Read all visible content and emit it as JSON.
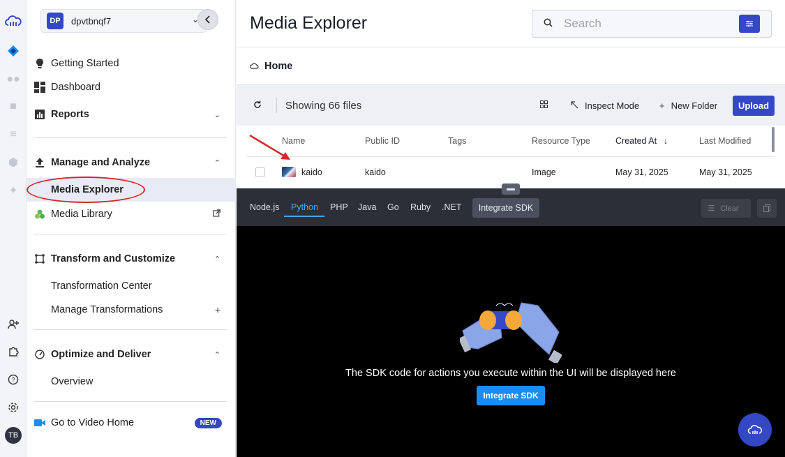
{
  "account": {
    "initials": "DP",
    "name": "dpvtbnqf7"
  },
  "user": {
    "initials": "TB"
  },
  "nav": {
    "getting_started": "Getting Started",
    "dashboard": "Dashboard",
    "reports": "Reports",
    "manage_analyze": "Manage and Analyze",
    "media_explorer": "Media Explorer",
    "media_library": "Media Library",
    "transform_customize": "Transform and Customize",
    "transformation_center": "Transformation Center",
    "manage_transformations": "Manage Transformations",
    "optimize_deliver": "Optimize and Deliver",
    "overview": "Overview",
    "video_home": "Go to Video Home",
    "new_badge": "NEW"
  },
  "header": {
    "title": "Media Explorer",
    "search_placeholder": "Search"
  },
  "breadcrumb": {
    "home": "Home"
  },
  "toolbar": {
    "count": "Showing 66 files",
    "inspect": "Inspect Mode",
    "new_folder": "New Folder",
    "upload": "Upload"
  },
  "table": {
    "columns": [
      "Name",
      "Public ID",
      "Tags",
      "Resource Type",
      "Created At",
      "Last Modified"
    ],
    "rows": [
      {
        "name": "kaido",
        "public_id": "kaido",
        "tags": "",
        "resource_type": "Image",
        "created_at": "May 31, 2025",
        "last_modified": "May 31, 2025"
      }
    ]
  },
  "sdk": {
    "languages": [
      "Node.js",
      "Python",
      "PHP",
      "Java",
      "Go",
      "Ruby",
      ".NET"
    ],
    "active_language": "Python",
    "integrate_label": "Integrate SDK",
    "clear_label": "Clear",
    "empty_message": "The SDK code for actions you execute within the UI will be displayed here",
    "integrate_button": "Integrate SDK"
  },
  "colors": {
    "brand": "#3448c5",
    "sdk_accent": "#1c8cf0",
    "annotation": "#d32a2a"
  }
}
